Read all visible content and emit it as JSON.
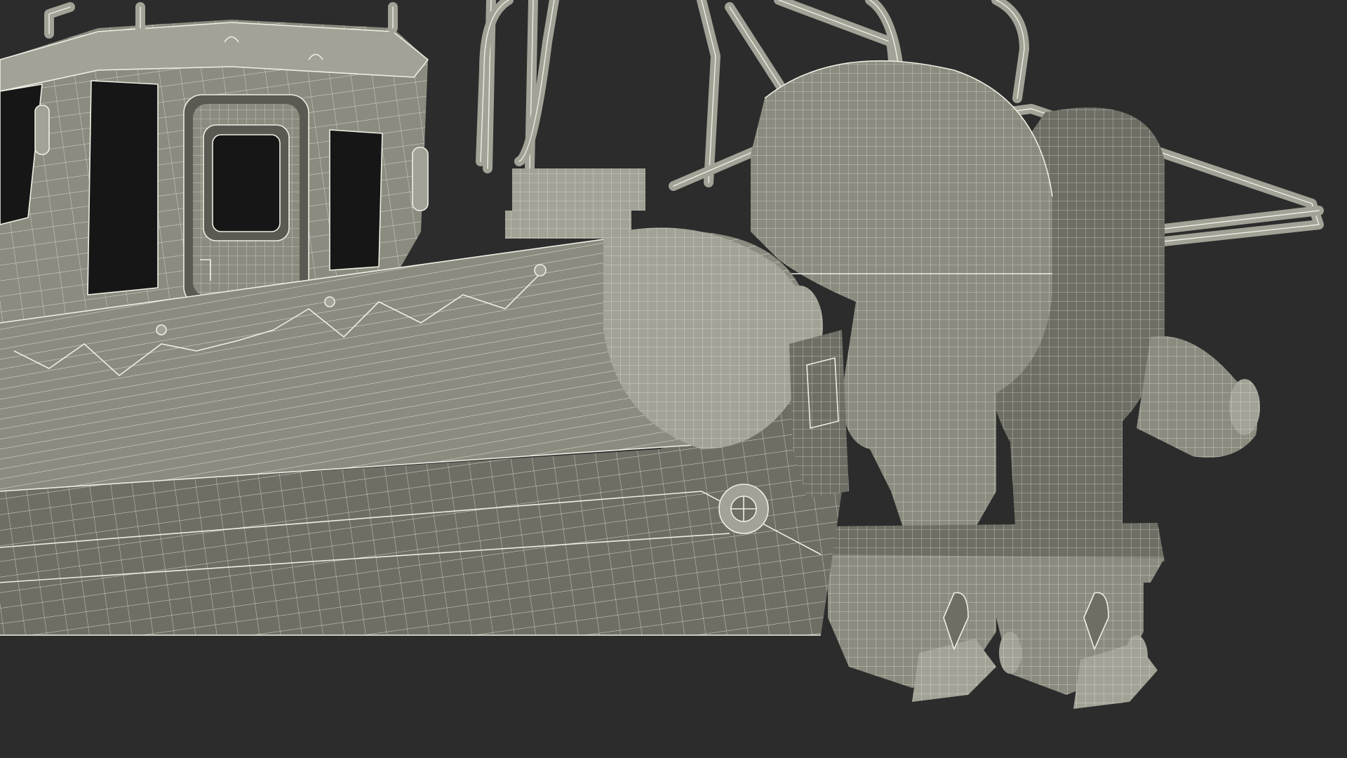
{
  "colors": {
    "background": "#2c2c2c",
    "surface": "#8c8b80",
    "surface_dark": "#6f6e65",
    "surface_light": "#a3a297",
    "wire": "#eeeee4",
    "glass": "#161616",
    "glass_frame": "#5b5a52"
  }
}
